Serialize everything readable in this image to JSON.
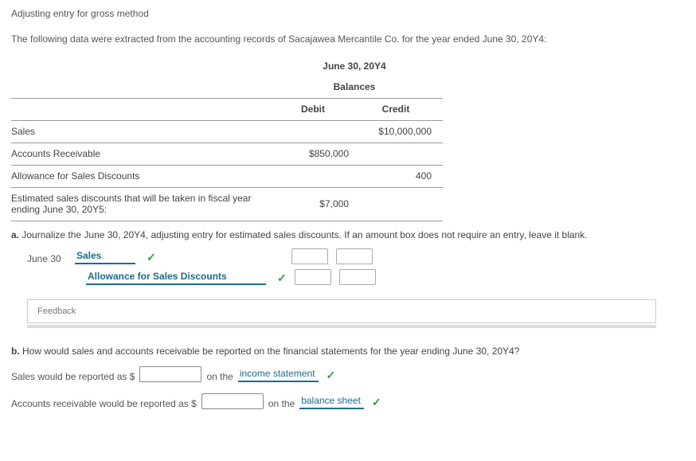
{
  "title": "Adjusting entry for gross method",
  "intro": "The following data were extracted from the accounting records of Sacajawea Mercantile Co. for the year ended June 30, 20Y4:",
  "balances": {
    "heading_date": "June 30, 20Y4",
    "heading_bal": "Balances",
    "col_debit": "Debit",
    "col_credit": "Credit",
    "rows": [
      {
        "label": "Sales",
        "debit": "",
        "credit": "$10,000,000"
      },
      {
        "label": "Accounts Receivable",
        "debit": "$850,000",
        "credit": ""
      },
      {
        "label": "Allowance for Sales Discounts",
        "debit": "",
        "credit": "400"
      },
      {
        "label": "Estimated sales discounts that will be taken in fiscal year ending June 30, 20Y5:",
        "debit": "$7,000",
        "credit": ""
      }
    ]
  },
  "part_a": {
    "label_prefix": "a.",
    "text": "Journalize the June 30, 20Y4, adjusting entry for estimated sales discounts. If an amount box does not require an entry, leave it blank.",
    "date": "June 30",
    "line1_account": "Sales",
    "line2_account": "Allowance for Sales Discounts",
    "feedback": "Feedback"
  },
  "part_b": {
    "label_prefix": "b.",
    "text": "How would sales and accounts receivable be reported on the financial statements for the year ending June 30, 20Y4?",
    "line1_pre": "Sales would be reported as $",
    "line1_mid": "on the",
    "line1_link": "income statement",
    "line2_pre": "Accounts receivable would be reported as $",
    "line2_mid": "on the",
    "line2_link": "balance sheet"
  }
}
